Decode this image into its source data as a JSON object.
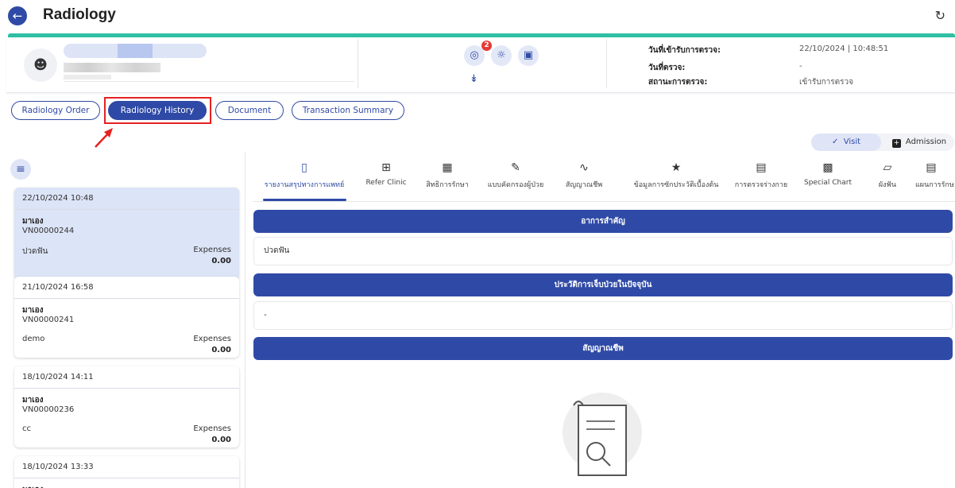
{
  "header": {
    "title": "Radiology",
    "back_icon": "arrow-left-icon",
    "refresh_icon": "refresh-icon"
  },
  "patient": {
    "avatar_icon": "person-icon",
    "action_icons": [
      "stomach-icon",
      "sun-icon",
      "note-icon"
    ],
    "badge_count": "2",
    "expand_icon": "double-chevron-down-icon",
    "info": [
      {
        "label": "วันที่เข้ารับการตรวจ:",
        "value": "22/10/2024 | 10:48:51"
      },
      {
        "label": "วันที่ตรวจ:",
        "value": "-"
      },
      {
        "label": "สถานะการตรวจ:",
        "value": "เข้ารับการตรวจ"
      }
    ]
  },
  "tabs": [
    {
      "label": "Radiology Order"
    },
    {
      "label": "Radiology History"
    },
    {
      "label": "Document"
    },
    {
      "label": "Transaction Summary"
    }
  ],
  "toggle": {
    "visit": "Visit",
    "admission": "Admission"
  },
  "visits": [
    {
      "date": "22/10/2024 10:48",
      "type": "มาเอง",
      "vn": "VN00000244",
      "note": "ปวดฟัน",
      "expenses_label": "Expenses",
      "expenses": "0.00"
    },
    {
      "date": "21/10/2024 16:58",
      "type": "มาเอง",
      "vn": "VN00000241",
      "note": "demo",
      "expenses_label": "Expenses",
      "expenses": "0.00"
    },
    {
      "date": "18/10/2024 14:11",
      "type": "มาเอง",
      "vn": "VN00000236",
      "note": "cc",
      "expenses_label": "Expenses",
      "expenses": "0.00"
    },
    {
      "date": "18/10/2024 13:33",
      "type": "มาเอง",
      "vn": "",
      "note": "",
      "expenses_label": "",
      "expenses": ""
    }
  ],
  "section_tabs": [
    {
      "label": "รายงานสรุปทางการแพทย์",
      "icon": "document-icon"
    },
    {
      "label": "Refer Clinic",
      "icon": "refer-icon"
    },
    {
      "label": "สิทธิการรักษา",
      "icon": "id-card-icon"
    },
    {
      "label": "แบบคัดกรองผู้ป่วย",
      "icon": "pen-icon"
    },
    {
      "label": "สัญญาณชีพ",
      "icon": "pulse-icon"
    },
    {
      "label": "ข้อมูลการซักประวัติเบื้องต้น",
      "icon": "body-icon"
    },
    {
      "label": "การตรวจร่างกาย",
      "icon": "exam-icon"
    },
    {
      "label": "Special Chart",
      "icon": "chart-icon"
    },
    {
      "label": "ผังฟัน",
      "icon": "tooth-icon"
    },
    {
      "label": "แผนการรักษ",
      "icon": "plan-icon"
    }
  ],
  "sections": [
    {
      "title": "อาการสำคัญ",
      "body": "ปวดฟัน"
    },
    {
      "title": "ประวัติการเจ็บป่วยในปัจจุบัน",
      "body": "-"
    },
    {
      "title": "สัญญาณชีพ",
      "body": ""
    }
  ]
}
